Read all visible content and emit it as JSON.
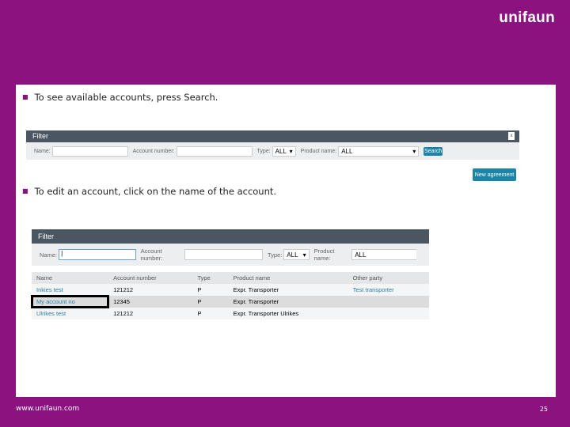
{
  "logo": "unifaun",
  "bullets": [
    "To see available accounts, press Search.",
    "To edit an account, click on the name of the account."
  ],
  "filter1": {
    "title": "Filter",
    "close": "x",
    "name_label": "Name:",
    "account_label": "Account number:",
    "type_label": "Type:",
    "type_value": "ALL",
    "product_label": "Product name:",
    "product_value": "ALL",
    "search": "Search",
    "new_agreement": "New agreement"
  },
  "filter2": {
    "title": "Filter",
    "name_label": "Name:",
    "account_label": "Account number:",
    "type_label": "Type:",
    "type_value": "ALL",
    "product_label": "Product name:",
    "product_value": "ALL"
  },
  "table": {
    "headers": [
      "Name",
      "Account number",
      "Type",
      "Product name",
      "Other party"
    ],
    "rows": [
      [
        "Inkies test",
        "121212",
        "P",
        "Expr. Transporter",
        "Test transporter"
      ],
      [
        "My account no",
        "12345",
        "P",
        "Expr. Transporter",
        ""
      ],
      [
        "Ulrikes test",
        "121212",
        "P",
        "Expr. Transporter Ulrikes",
        ""
      ]
    ]
  },
  "footer": "www.unifaun.com",
  "page_number": "25"
}
